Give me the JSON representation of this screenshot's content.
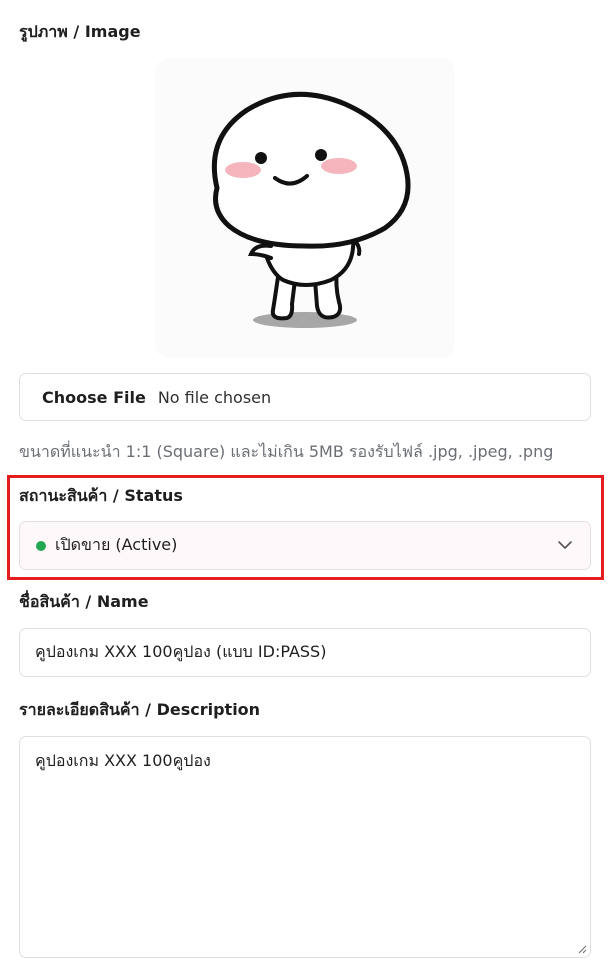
{
  "image_section": {
    "label": "รูปภาพ / Image",
    "preview_icon": "cartoon-character-icon"
  },
  "file_upload": {
    "button_label": "Choose File",
    "status": "No file chosen",
    "hint": "ขนาดที่แนะนำ 1:1 (Square) และไม่เกิน 5MB รองรับไฟล์ .jpg, .jpeg, .png"
  },
  "status_section": {
    "label": "สถานะสินค้า / Status",
    "selected": "เปิดขาย (Active)",
    "indicator_color": "#22a852",
    "highlight_color": "#e41e1e"
  },
  "name_section": {
    "label": "ชื่อสินค้า / Name",
    "value": "คูปองเกม XXX 100คูปอง (แบบ ID:PASS)"
  },
  "description_section": {
    "label": "รายละเอียดสินค้า / Description",
    "value": "คูปองเกม XXX 100คูปอง"
  }
}
